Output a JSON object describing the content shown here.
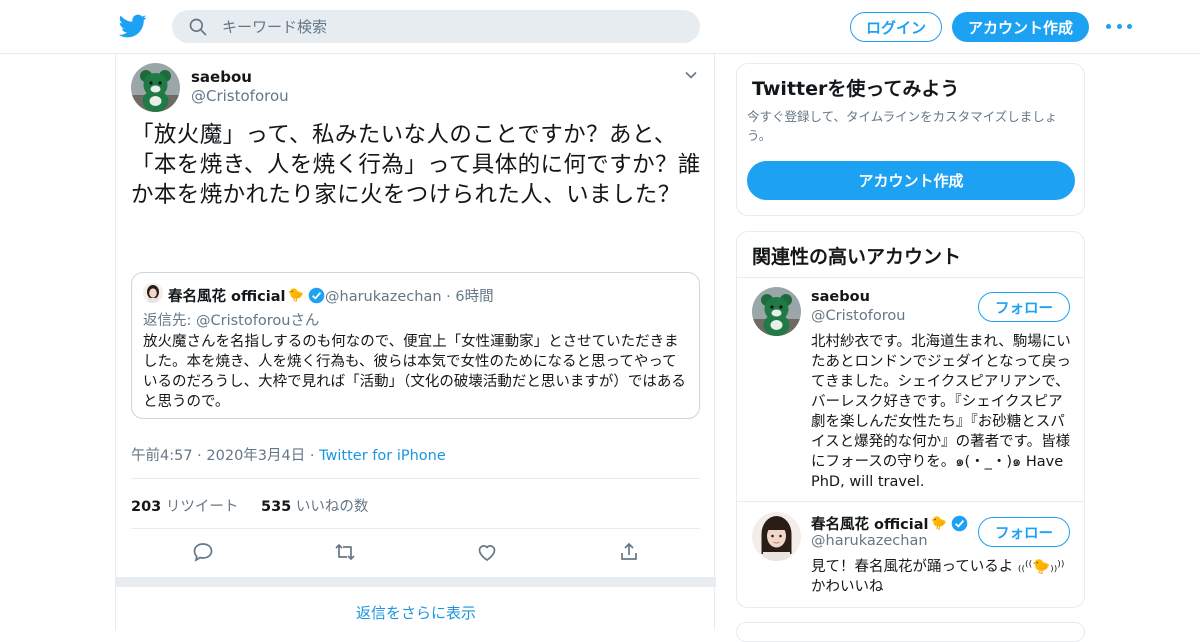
{
  "header": {
    "search_placeholder": "キーワード検索",
    "login_label": "ログイン",
    "signup_label": "アカウント作成"
  },
  "tweet": {
    "name": "saebou",
    "handle": "@Cristoforou",
    "text": "「放火魔」って、私みたいな人のことですか？あと、「本を焼き、人を焼く行為」って具体的に何ですか？誰か本を焼かれたり家に火をつけられた人、いました？",
    "quote": {
      "name": "春名風花 official",
      "name_emoji": "🐤",
      "handle": "@harukazechan",
      "time": "6時間",
      "reply_prefix": "返信先: ",
      "reply_to": "@Cristoforouさん",
      "text": "放火魔さんを名指しするのも何なので、便宜上「女性運動家」とさせていただきました。本を焼き、人を焼く行為も、彼らは本気で女性のためになると思ってやっているのだろうし、大枠で見れば「活動」（文化の破壊活動だと思いますが）ではあると思うので。"
    },
    "timestamp": "午前4:57 · 2020年3月4日",
    "via": "Twitter for iPhone",
    "retweets": "203",
    "retweets_label": "リツイート",
    "likes": "535",
    "likes_label": "いいねの数",
    "more_replies": "返信をさらに表示"
  },
  "sidebar": {
    "try": {
      "title": "Twitterを使ってみよう",
      "subtitle": "今すぐ登録して、タイムラインをカスタマイズしましょう。",
      "button": "アカウント作成"
    },
    "related": {
      "title": "関連性の高いアカウント",
      "follow_label": "フォロー",
      "accounts": [
        {
          "name": "saebou",
          "handle": "@Cristoforou",
          "bio": "北村紗衣です。北海道生まれ、駒場にいたあとロンドンでジェダイとなって戻ってきました。シェイクスピアリアンで、バーレスク好きです。『シェイクスピア劇を楽しんだ女性たち』『お砂糖とスパイスと爆発的な何か』の著者です。皆様にフォースの守りを。๑(・_・)๑ Have PhD, will travel."
        },
        {
          "name": "春名風花 official",
          "name_emoji": "🐤",
          "handle": "@harukazechan",
          "bio": "見て！春名風花が踊っているよ ₍₍⁽⁽🐤₎₎⁾⁾ かわいいね"
        }
      ]
    }
  },
  "colors": {
    "accent": "#1da1f2",
    "link": "#1b95e0",
    "secondary_text": "#657786",
    "border": "#e6ecf0"
  }
}
